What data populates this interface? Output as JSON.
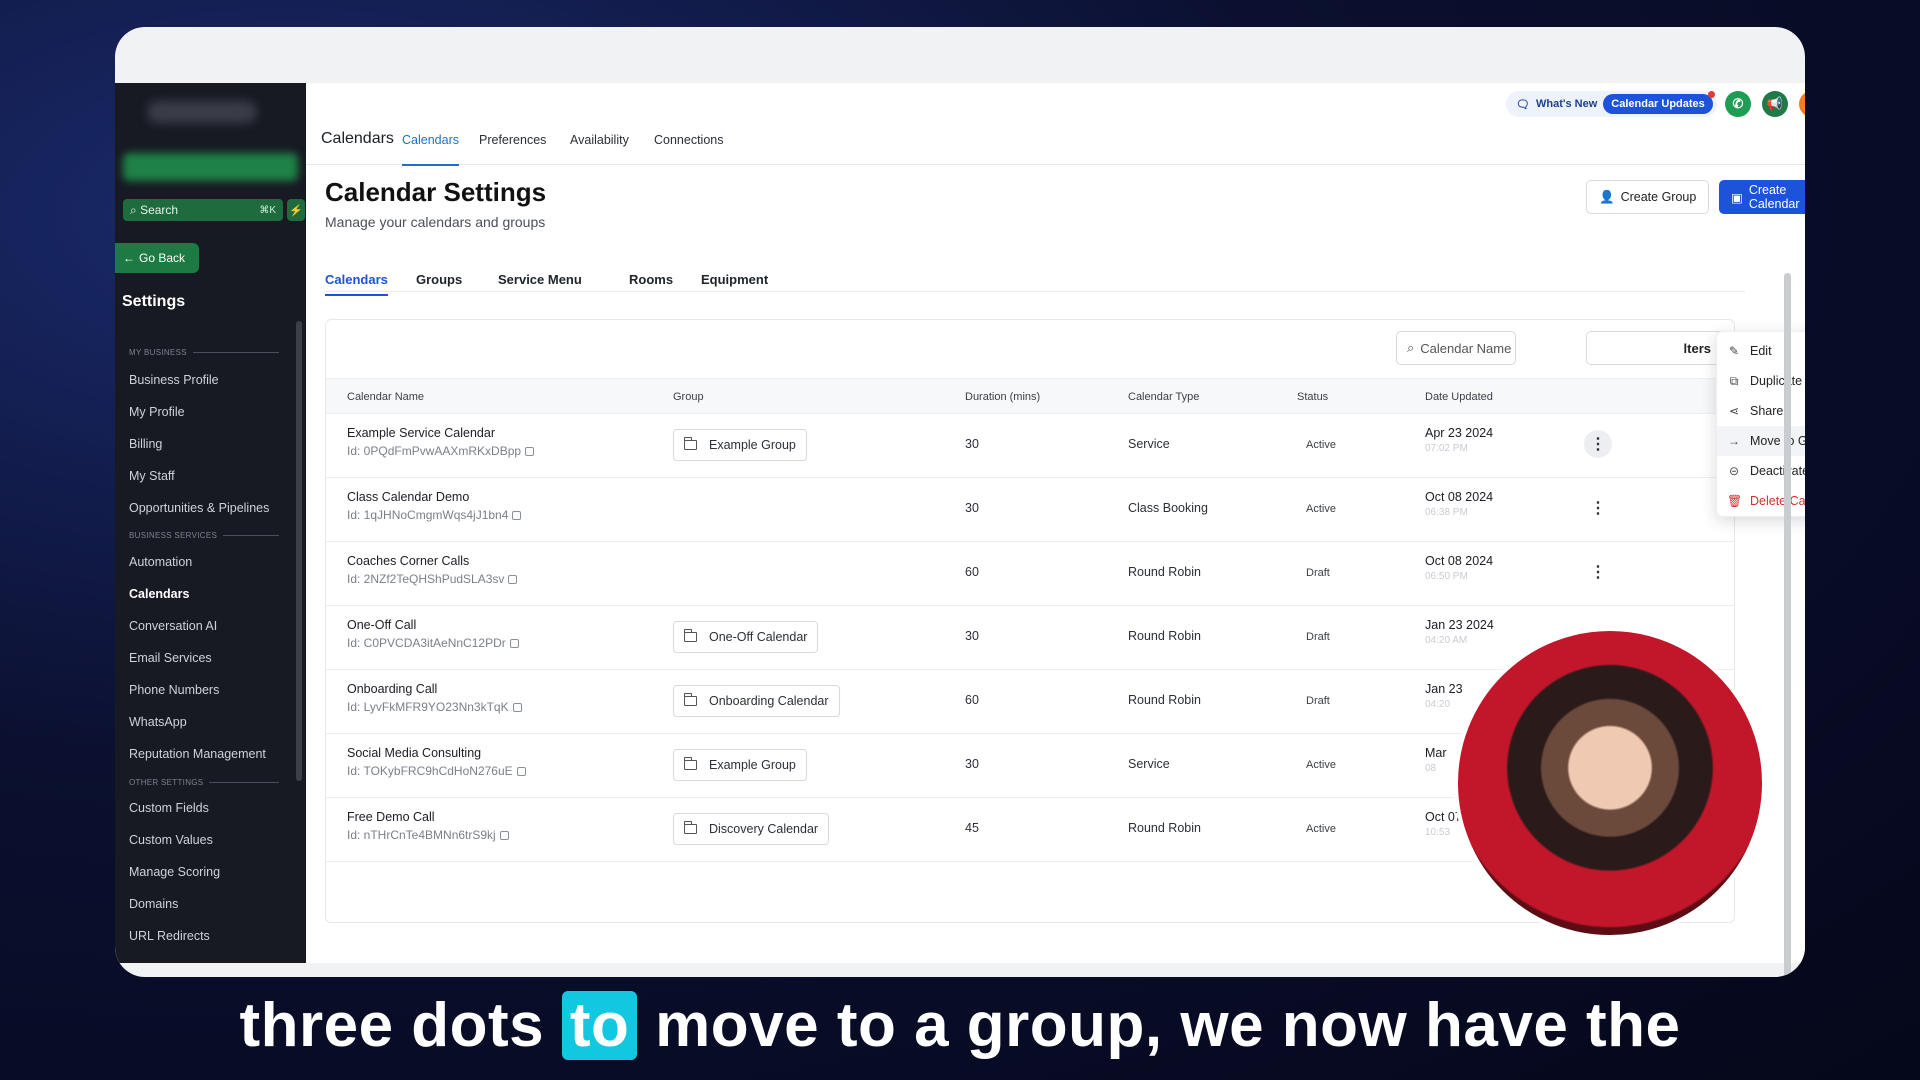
{
  "sidebar": {
    "search_label": "Search",
    "search_shortcut": "⌘K",
    "back_label": "Go Back",
    "title": "Settings",
    "sections": {
      "my_business": "MY BUSINESS",
      "business_services": "BUSINESS SERVICES",
      "other_settings": "OTHER SETTINGS"
    },
    "items": [
      "Business Profile",
      "My Profile",
      "Billing",
      "My Staff",
      "Opportunities & Pipelines",
      "Automation",
      "Calendars",
      "Conversation AI",
      "Email Services",
      "Phone Numbers",
      "WhatsApp",
      "Reputation Management",
      "Custom Fields",
      "Custom Values",
      "Manage Scoring",
      "Domains",
      "URL Redirects"
    ]
  },
  "topbar": {
    "title": "Calendars",
    "tabs": [
      "Calendars",
      "Preferences",
      "Availability",
      "Connections"
    ],
    "whats_new": "What's New",
    "updates_pill": "Calendar Updates",
    "help": "?"
  },
  "page": {
    "title": "Calendar Settings",
    "subtitle": "Manage your calendars and groups",
    "create_group": "Create Group",
    "create_calendar": "Create Calendar",
    "sub_tabs": [
      "Calendars",
      "Groups",
      "Service Menu",
      "Rooms",
      "Equipment"
    ],
    "search_placeholder": "Calendar Name",
    "filters_label": "lters"
  },
  "table": {
    "headers": [
      "Calendar Name",
      "Group",
      "Duration (mins)",
      "Calendar Type",
      "Status",
      "Date Updated"
    ],
    "rows": [
      {
        "name": "Example Service Calendar",
        "id": "Id: 0PQdFmPvwAAXmRKxDBpp",
        "group": "Example Group",
        "duration": "30",
        "type": "Service",
        "status": "Active",
        "date": "Apr 23 2024",
        "time": "07:02 PM"
      },
      {
        "name": "Class Calendar Demo",
        "id": "Id: 1qJHNoCmgmWqs4jJ1bn4",
        "group": "",
        "duration": "30",
        "type": "Class Booking",
        "status": "Active",
        "date": "Oct 08 2024",
        "time": "06:38 PM"
      },
      {
        "name": "Coaches Corner Calls",
        "id": "Id: 2NZf2TeQHShPudSLA3sv",
        "group": "",
        "duration": "60",
        "type": "Round Robin",
        "status": "Draft",
        "date": "Oct 08 2024",
        "time": "06:50 PM"
      },
      {
        "name": "One-Off Call",
        "id": "Id: C0PVCDA3itAeNnC12PDr",
        "group": "One-Off Calendar",
        "duration": "30",
        "type": "Round Robin",
        "status": "Draft",
        "date": "Jan 23 2024",
        "time": "04:20 AM"
      },
      {
        "name": "Onboarding Call",
        "id": "Id: LyvFkMFR9YO23Nn3kTqK",
        "group": "Onboarding Calendar",
        "duration": "60",
        "type": "Round Robin",
        "status": "Draft",
        "date": "Jan 23",
        "time": "04:20"
      },
      {
        "name": "Social Media Consulting",
        "id": "Id: TOKybFRC9hCdHoN276uE",
        "group": "Example Group",
        "duration": "30",
        "type": "Service",
        "status": "Active",
        "date": "Mar",
        "time": "08"
      },
      {
        "name": "Free Demo Call",
        "id": "Id: nTHrCnTe4BMNn6trS9kj",
        "group": "Discovery Calendar",
        "duration": "45",
        "type": "Round Robin",
        "status": "Active",
        "date": "Oct 07",
        "time": "10:53"
      }
    ]
  },
  "menu": {
    "items": [
      {
        "label": "Edit",
        "icon": "pencil-icon"
      },
      {
        "label": "Duplicate",
        "icon": "duplicate-icon"
      },
      {
        "label": "Share",
        "icon": "share-icon"
      },
      {
        "label": "Move to Group",
        "icon": "arrow-right-icon"
      },
      {
        "label": "Deactivate Calendar",
        "icon": "toggle-icon"
      },
      {
        "label": "Delete Calendar",
        "icon": "trash-icon"
      }
    ]
  },
  "caption": {
    "before": "three dots",
    "highlight": "to",
    "after": "move to a group, we now have the"
  },
  "colors": {
    "accent": "#1d53d8",
    "sidebar_bg": "#171a22",
    "sidebar_green": "#1e7a43",
    "danger": "#d32f2f",
    "caption_highlight": "#12c7e0"
  }
}
